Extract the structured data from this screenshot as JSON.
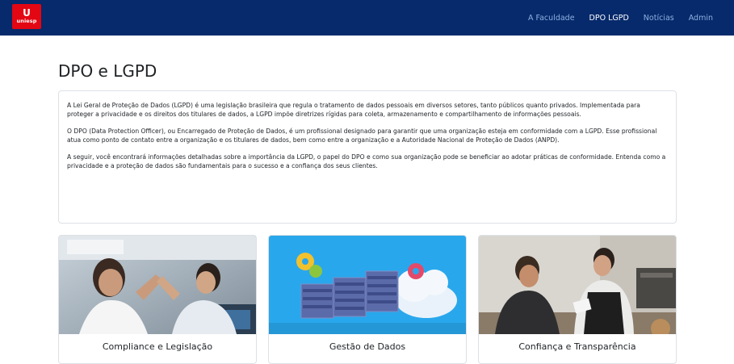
{
  "navbar": {
    "logo_text": "uniesp",
    "logo_mark": "U",
    "links": [
      {
        "label": "A Faculdade",
        "active": false
      },
      {
        "label": "DPO LGPD",
        "active": true
      },
      {
        "label": "Notícias",
        "active": false
      },
      {
        "label": "Admin",
        "active": false
      }
    ]
  },
  "page": {
    "title": "DPO e LGPD"
  },
  "intro": {
    "paragraphs": [
      "A Lei Geral de Proteção de Dados (LGPD) é uma legislação brasileira que regula o tratamento de dados pessoais em diversos setores, tanto públicos quanto privados. Implementada para proteger a privacidade e os direitos dos titulares de dados, a LGPD impõe diretrizes rígidas para coleta, armazenamento e compartilhamento de informações pessoais.",
      "O DPO (Data Protection Officer), ou Encarregado de Proteção de Dados, é um profissional designado para garantir que uma organização esteja em conformidade com a LGPD. Esse profissional atua como ponto de contato entre a organização e os titulares de dados, bem como entre a organização e a Autoridade Nacional de Proteção de Dados (ANPD).",
      "A seguir, você encontrará informações detalhadas sobre a importância da LGPD, o papel do DPO e como sua organização pode se beneficiar ao adotar práticas de conformidade. Entenda como a privacidade e a proteção de dados são fundamentais para o sucesso e a confiança dos seus clientes."
    ]
  },
  "cards": [
    {
      "title": "Compliance e Legislação"
    },
    {
      "title": "Gestão de Dados"
    },
    {
      "title": "Confiança e Transparência"
    }
  ],
  "colors": {
    "navbar_bg": "#062a6b",
    "logo_bg": "#e30613",
    "nav_link": "#8fb0e2",
    "nav_link_active": "#ffffff"
  }
}
